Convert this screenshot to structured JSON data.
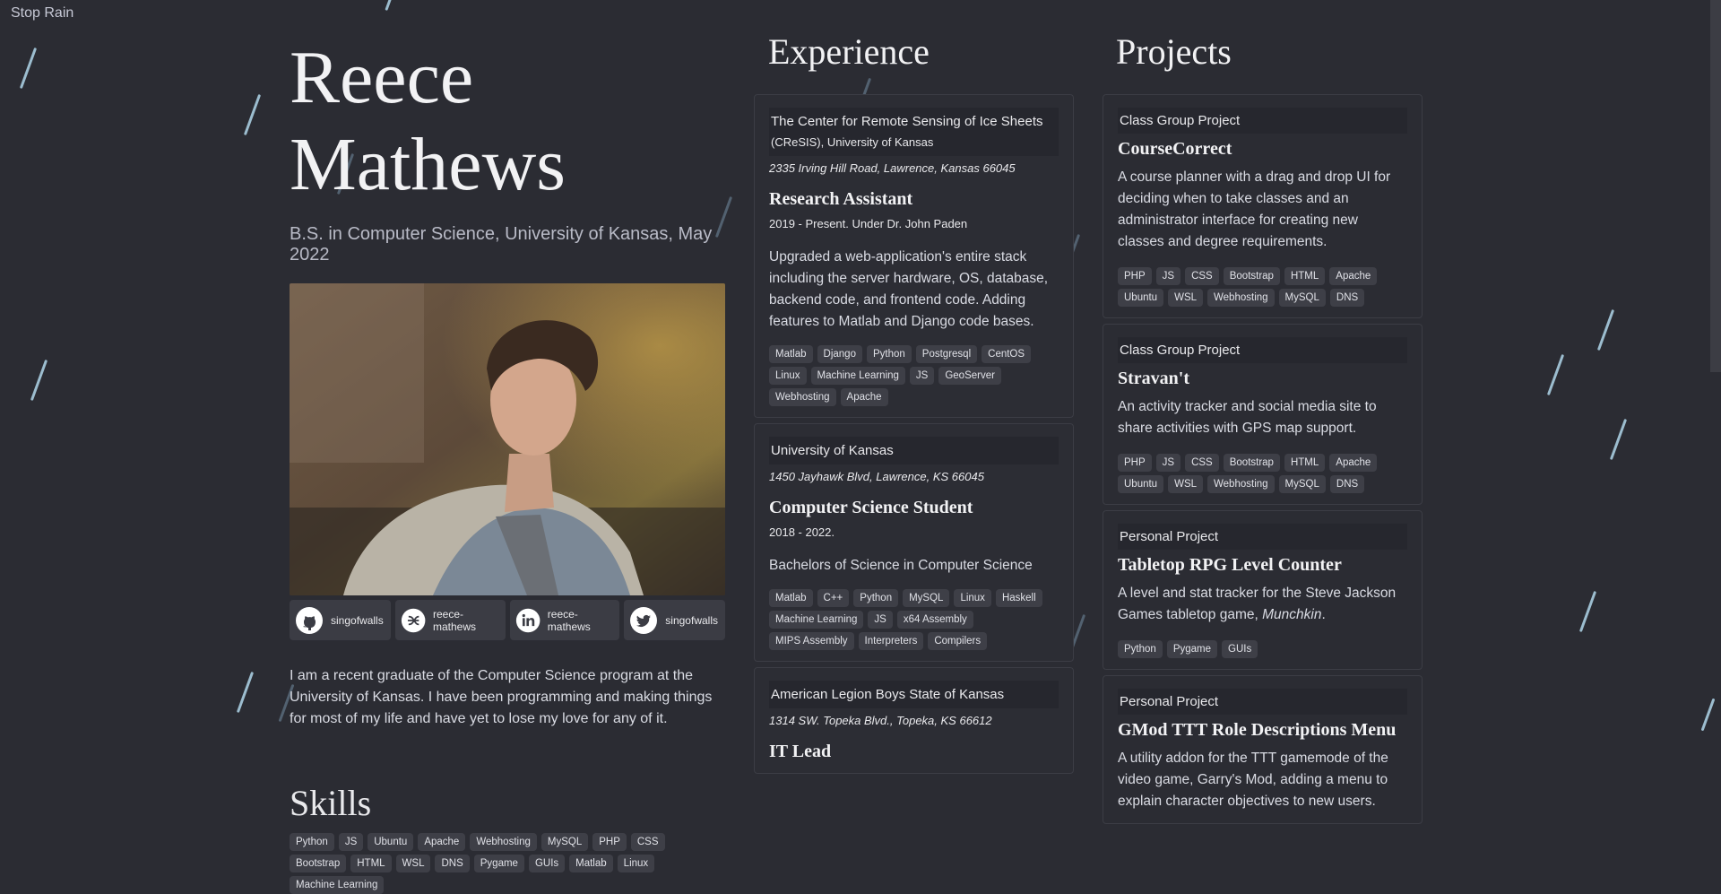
{
  "rain_toggle": "Stop Rain",
  "profile": {
    "name_line1": "Reece",
    "name_line2": "Mathews",
    "degree": "B.S. in Computer Science, University of Kansas, May 2022",
    "photo_icon": "profile-photo",
    "socials": [
      {
        "icon": "github-icon",
        "label": "singofwalls"
      },
      {
        "icon": "stackshare-icon",
        "label": "reece-mathews"
      },
      {
        "icon": "linkedin-icon",
        "label": "reece-mathews"
      },
      {
        "icon": "twitter-icon",
        "label": "singofwalls"
      }
    ],
    "bio": "I am a recent graduate of the Computer Science program at the University of Kansas. I have been programming and making things for most of my life and have yet to lose my love for any of it."
  },
  "skills": {
    "title": "Skills",
    "tags": [
      "Python",
      "JS",
      "Ubuntu",
      "Apache",
      "Webhosting",
      "MySQL",
      "PHP",
      "CSS",
      "Bootstrap",
      "HTML",
      "WSL",
      "DNS",
      "Pygame",
      "GUIs",
      "Matlab",
      "Linux",
      "Machine Learning"
    ]
  },
  "experience": {
    "title": "Experience",
    "items": [
      {
        "org_line1": "The Center for Remote Sensing of Ice Sheets",
        "org_line2": "(CReSIS), University of Kansas",
        "address": "2335 Irving Hill Road, Lawrence, Kansas 66045",
        "role": "Research Assistant",
        "dates": "2019 - Present. Under Dr. John Paden",
        "description": "Upgraded a web-application's entire stack including the server hardware, OS, database, backend code, and frontend code. Adding features to Matlab and Django code bases.",
        "tags": [
          "Matlab",
          "Django",
          "Python",
          "Postgresql",
          "CentOS",
          "Linux",
          "Machine Learning",
          "JS",
          "GeoServer",
          "Webhosting",
          "Apache"
        ]
      },
      {
        "org_line1": "University of Kansas",
        "address": "1450 Jayhawk Blvd, Lawrence, KS 66045",
        "role": "Computer Science Student",
        "dates": "2018 - 2022.",
        "description": "Bachelors of Science in Computer Science",
        "tags": [
          "Matlab",
          "C++",
          "Python",
          "MySQL",
          "Linux",
          "Haskell",
          "Machine Learning",
          "JS",
          "x64 Assembly",
          "MIPS Assembly",
          "Interpreters",
          "Compilers"
        ]
      },
      {
        "org_line1": "American Legion Boys State of Kansas",
        "address": "1314 SW. Topeka Blvd., Topeka, KS 66612",
        "role": "IT Lead"
      }
    ]
  },
  "projects": {
    "title": "Projects",
    "items": [
      {
        "kind": "Class Group Project",
        "title": "CourseCorrect",
        "description": "A course planner with a drag and drop UI for deciding when to take classes and an administrator interface for creating new classes and degree requirements.",
        "tags": [
          "PHP",
          "JS",
          "CSS",
          "Bootstrap",
          "HTML",
          "Apache",
          "Ubuntu",
          "WSL",
          "Webhosting",
          "MySQL",
          "DNS"
        ]
      },
      {
        "kind": "Class Group Project",
        "title": "Stravan't",
        "description": "An activity tracker and social media site to share activities with GPS map support.",
        "tags": [
          "PHP",
          "JS",
          "CSS",
          "Bootstrap",
          "HTML",
          "Apache",
          "Ubuntu",
          "WSL",
          "Webhosting",
          "MySQL",
          "DNS"
        ]
      },
      {
        "kind": "Personal Project",
        "title": "Tabletop RPG Level Counter",
        "description_prefix": "A level and stat tracker for the Steve Jackson Games tabletop game, ",
        "description_em": "Munchkin",
        "description_suffix": ".",
        "tags": [
          "Python",
          "Pygame",
          "GUIs"
        ]
      },
      {
        "kind": "Personal Project",
        "title": "GMod TTT Role Descriptions Menu",
        "description": "A utility addon for the TTT gamemode of the video game, Garry's Mod, adding a menu to explain character objectives to new users."
      }
    ]
  },
  "colors": {
    "background": "#2b2c33",
    "tag": "#3e3f47",
    "rain": "#a9cde0"
  }
}
